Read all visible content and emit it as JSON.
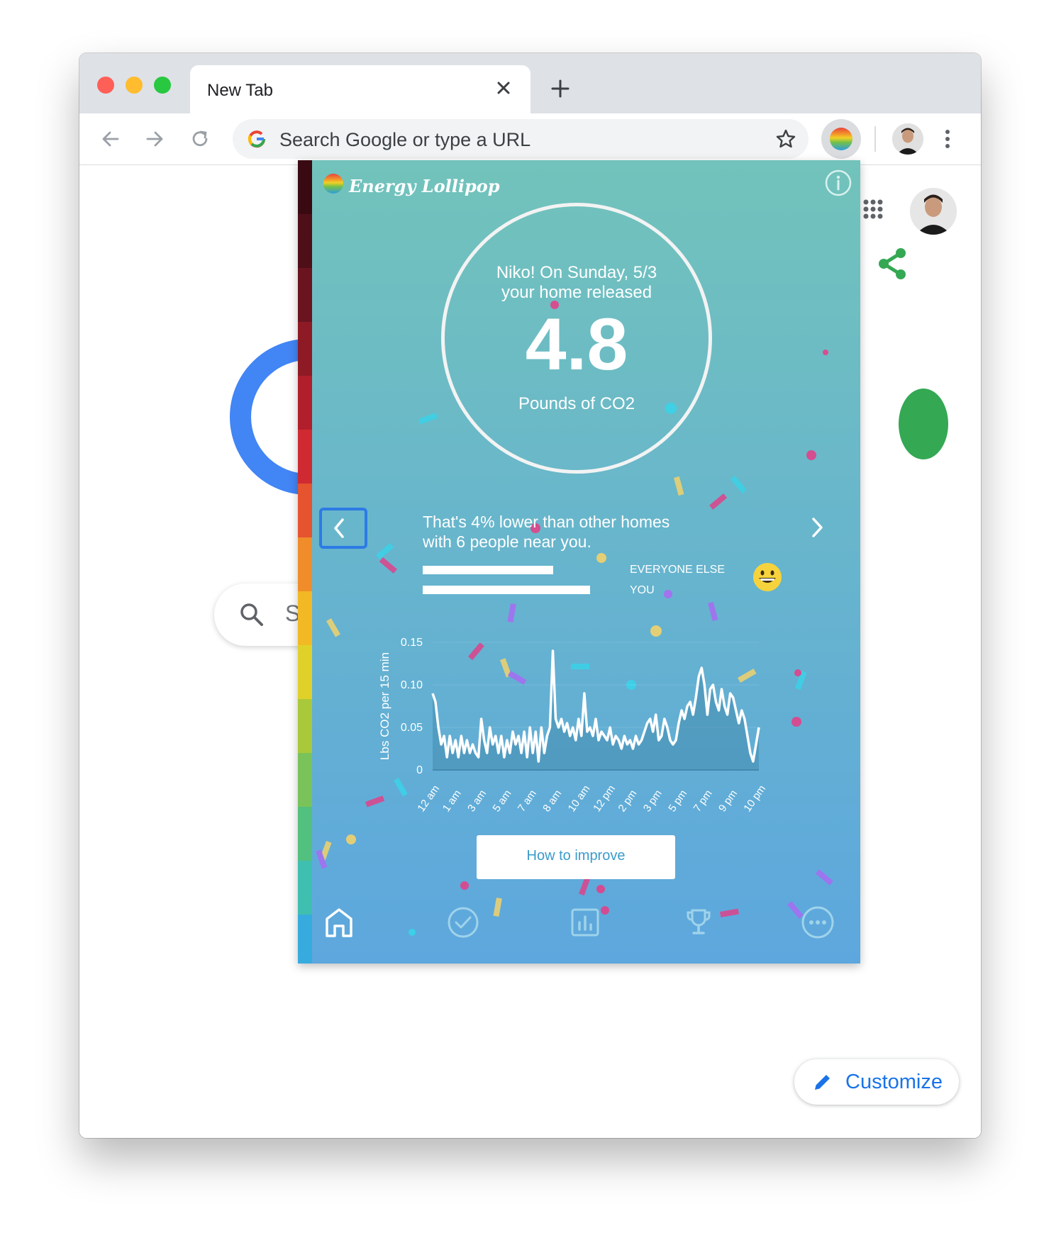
{
  "browser": {
    "tab_title": "New Tab",
    "omnibox_placeholder": "Search Google or type a URL"
  },
  "page": {
    "search_letter": "S",
    "customize_label": "Customize"
  },
  "popup": {
    "logo_text": "Energy Lollipop",
    "circle_line1": "Niko! On Sunday, 5/3",
    "circle_line2": "your home released",
    "big_number": "4.8",
    "unit": "Pounds of CO2",
    "compare_line1": "That's 4% lower than other homes",
    "compare_line2": "with 6 people near you.",
    "everyone_else_label": "EVERYONE ELSE",
    "you_label": "YOU",
    "everyone_else_value": 0.78,
    "you_value": 1.0,
    "improve_label": "How to improve",
    "stripe_colors": [
      "#3a0a12",
      "#4f0f18",
      "#6a1420",
      "#8e1a25",
      "#b01f2b",
      "#cf2a32",
      "#e5542e",
      "#f08d2a",
      "#f2b925",
      "#e0d12a",
      "#a9c93a",
      "#79c35a",
      "#52c07e",
      "#3fbfb0",
      "#37abde",
      "#2f9ee0",
      "#2a8fe0"
    ],
    "nav_icons": [
      "home-icon",
      "check-circle-icon",
      "bar-chart-icon",
      "trophy-icon",
      "more-circle-icon"
    ]
  },
  "chart_data": {
    "type": "area",
    "ylabel": "Lbs CO2 per 15 min",
    "y_ticks": [
      "0",
      "0.05",
      "0.10",
      "0.15"
    ],
    "ylim": [
      0,
      0.15
    ],
    "x_tick_labels": [
      "12 am",
      "1 am",
      "3 am",
      "5 am",
      "7 am",
      "8 am",
      "10 am",
      "12 pm",
      "2 pm",
      "3 pm",
      "5 pm",
      "7 pm",
      "9 pm",
      "10 pm"
    ],
    "series": [
      {
        "values": [
          0.09,
          0.08,
          0.05,
          0.03,
          0.04,
          0.015,
          0.04,
          0.02,
          0.035,
          0.015,
          0.04,
          0.02,
          0.035,
          0.02,
          0.03,
          0.02,
          0.015,
          0.06,
          0.035,
          0.02,
          0.05,
          0.03,
          0.04,
          0.02,
          0.04,
          0.015,
          0.035,
          0.02,
          0.045,
          0.03,
          0.04,
          0.02,
          0.045,
          0.015,
          0.05,
          0.02,
          0.045,
          0.01,
          0.05,
          0.02,
          0.04,
          0.05,
          0.14,
          0.06,
          0.05,
          0.06,
          0.045,
          0.055,
          0.04,
          0.05,
          0.035,
          0.06,
          0.04,
          0.09,
          0.045,
          0.05,
          0.04,
          0.06,
          0.035,
          0.045,
          0.04,
          0.035,
          0.05,
          0.03,
          0.04,
          0.035,
          0.025,
          0.04,
          0.03,
          0.035,
          0.025,
          0.04,
          0.03,
          0.035,
          0.045,
          0.055,
          0.06,
          0.045,
          0.065,
          0.035,
          0.04,
          0.06,
          0.05,
          0.035,
          0.03,
          0.035,
          0.055,
          0.07,
          0.06,
          0.075,
          0.08,
          0.065,
          0.085,
          0.11,
          0.12,
          0.1,
          0.065,
          0.095,
          0.1,
          0.08,
          0.07,
          0.095,
          0.075,
          0.065,
          0.09,
          0.085,
          0.07,
          0.055,
          0.07,
          0.06,
          0.04,
          0.02,
          0.01,
          0.03,
          0.05
        ]
      }
    ]
  }
}
